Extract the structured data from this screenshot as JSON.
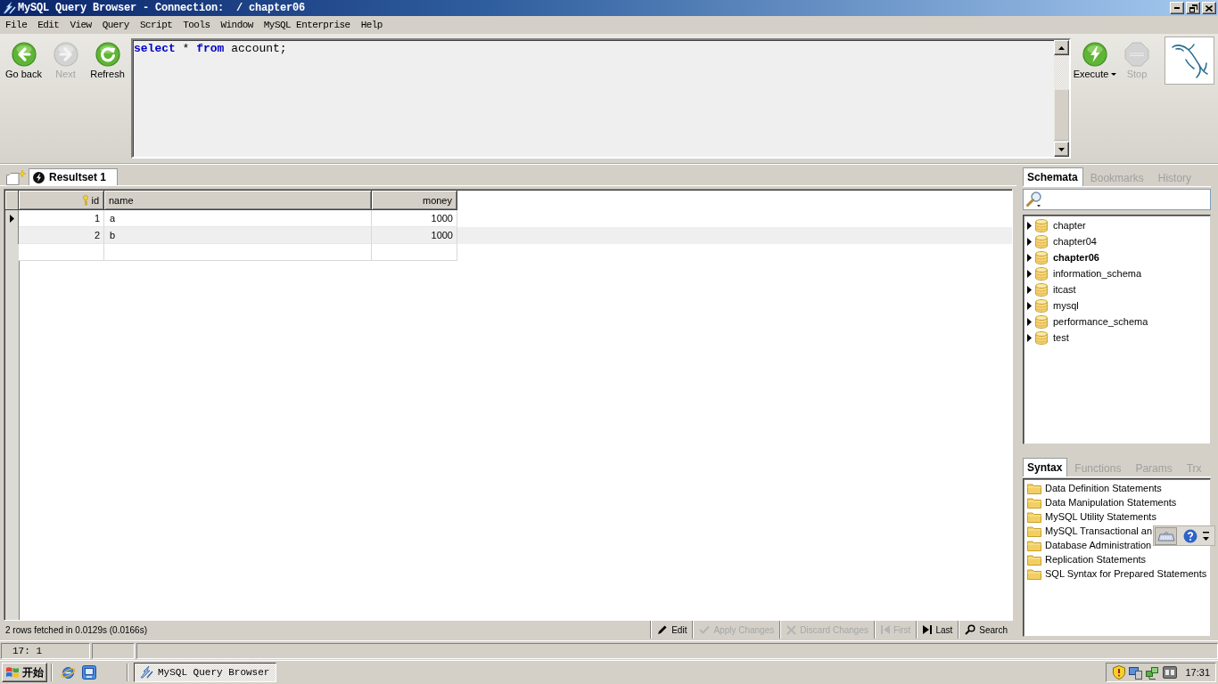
{
  "window": {
    "title": "MySQL Query Browser - Connection:  / chapter06"
  },
  "menu": [
    "File",
    "Edit",
    "View",
    "Query",
    "Script",
    "Tools",
    "Window",
    "MySQL Enterprise",
    "Help"
  ],
  "toolbar": {
    "nav_buttons": [
      {
        "kind": "back",
        "label": "Go back",
        "disabled": false
      },
      {
        "kind": "next",
        "label": "Next",
        "disabled": true
      },
      {
        "kind": "refresh",
        "label": "Refresh",
        "disabled": false
      }
    ],
    "query": [
      {
        "kind": "keyword",
        "text": "select"
      },
      {
        "kind": "plain",
        "text": " * "
      },
      {
        "kind": "keyword",
        "text": "from"
      },
      {
        "kind": "plain",
        "text": " account;"
      }
    ],
    "run_buttons": [
      {
        "kind": "execute",
        "label": "Execute",
        "disabled": false,
        "dropdown": true
      },
      {
        "kind": "stop",
        "label": "Stop",
        "disabled": true,
        "dropdown": false
      }
    ]
  },
  "result_tabs": [
    {
      "label": "Resultset 1",
      "selected": true
    }
  ],
  "result_grid": {
    "columns": [
      {
        "label": "id",
        "primary_key": true,
        "numeric": true
      },
      {
        "label": "name",
        "primary_key": false,
        "numeric": false
      },
      {
        "label": "money",
        "primary_key": false,
        "numeric": true
      }
    ],
    "rows": [
      {
        "current": true,
        "cells": [
          "1",
          "a",
          "1000"
        ]
      },
      {
        "current": false,
        "cells": [
          "2",
          "b",
          "1000"
        ]
      }
    ]
  },
  "result_status": {
    "message": "2 rows fetched in 0.0129s (0.0166s)",
    "actions": [
      {
        "kind": "edit",
        "label": "Edit",
        "disabled": false
      },
      {
        "kind": "apply",
        "label": "Apply Changes",
        "disabled": true
      },
      {
        "kind": "discard",
        "label": "Discard Changes",
        "disabled": true
      },
      {
        "kind": "first",
        "label": "First",
        "disabled": true
      },
      {
        "kind": "last",
        "label": "Last",
        "disabled": false
      },
      {
        "kind": "search",
        "label": "Search",
        "disabled": false
      }
    ]
  },
  "schema_tabs": [
    {
      "label": "Schemata",
      "selected": true
    },
    {
      "label": "Bookmarks",
      "selected": false
    },
    {
      "label": "History",
      "selected": false
    }
  ],
  "schemata": [
    {
      "name": "chapter",
      "default": false,
      "expanded": false
    },
    {
      "name": "chapter04",
      "default": false,
      "expanded": false
    },
    {
      "name": "chapter06",
      "default": true,
      "expanded": false
    },
    {
      "name": "information_schema",
      "default": false,
      "expanded": false
    },
    {
      "name": "itcast",
      "default": false,
      "expanded": false
    },
    {
      "name": "mysql",
      "default": false,
      "expanded": false
    },
    {
      "name": "performance_schema",
      "default": false,
      "expanded": false
    },
    {
      "name": "test",
      "default": false,
      "expanded": false
    }
  ],
  "syntax_tabs": [
    {
      "label": "Syntax",
      "selected": true
    },
    {
      "label": "Functions",
      "selected": false
    },
    {
      "label": "Params",
      "selected": false
    },
    {
      "label": "Trx",
      "selected": false
    }
  ],
  "syntax_topics": [
    "Data Definition Statements",
    "Data Manipulation Statements",
    "MySQL Utility Statements",
    "MySQL Transactional an",
    "Database Administration",
    "Replication Statements",
    "SQL Syntax for Prepared Statements"
  ],
  "status_bar": {
    "cursor": "17: 1"
  },
  "taskbar": {
    "start": "开始",
    "tasks": [
      {
        "label": "MySQL Query Browser",
        "active": true
      }
    ],
    "clock": "17:31"
  }
}
